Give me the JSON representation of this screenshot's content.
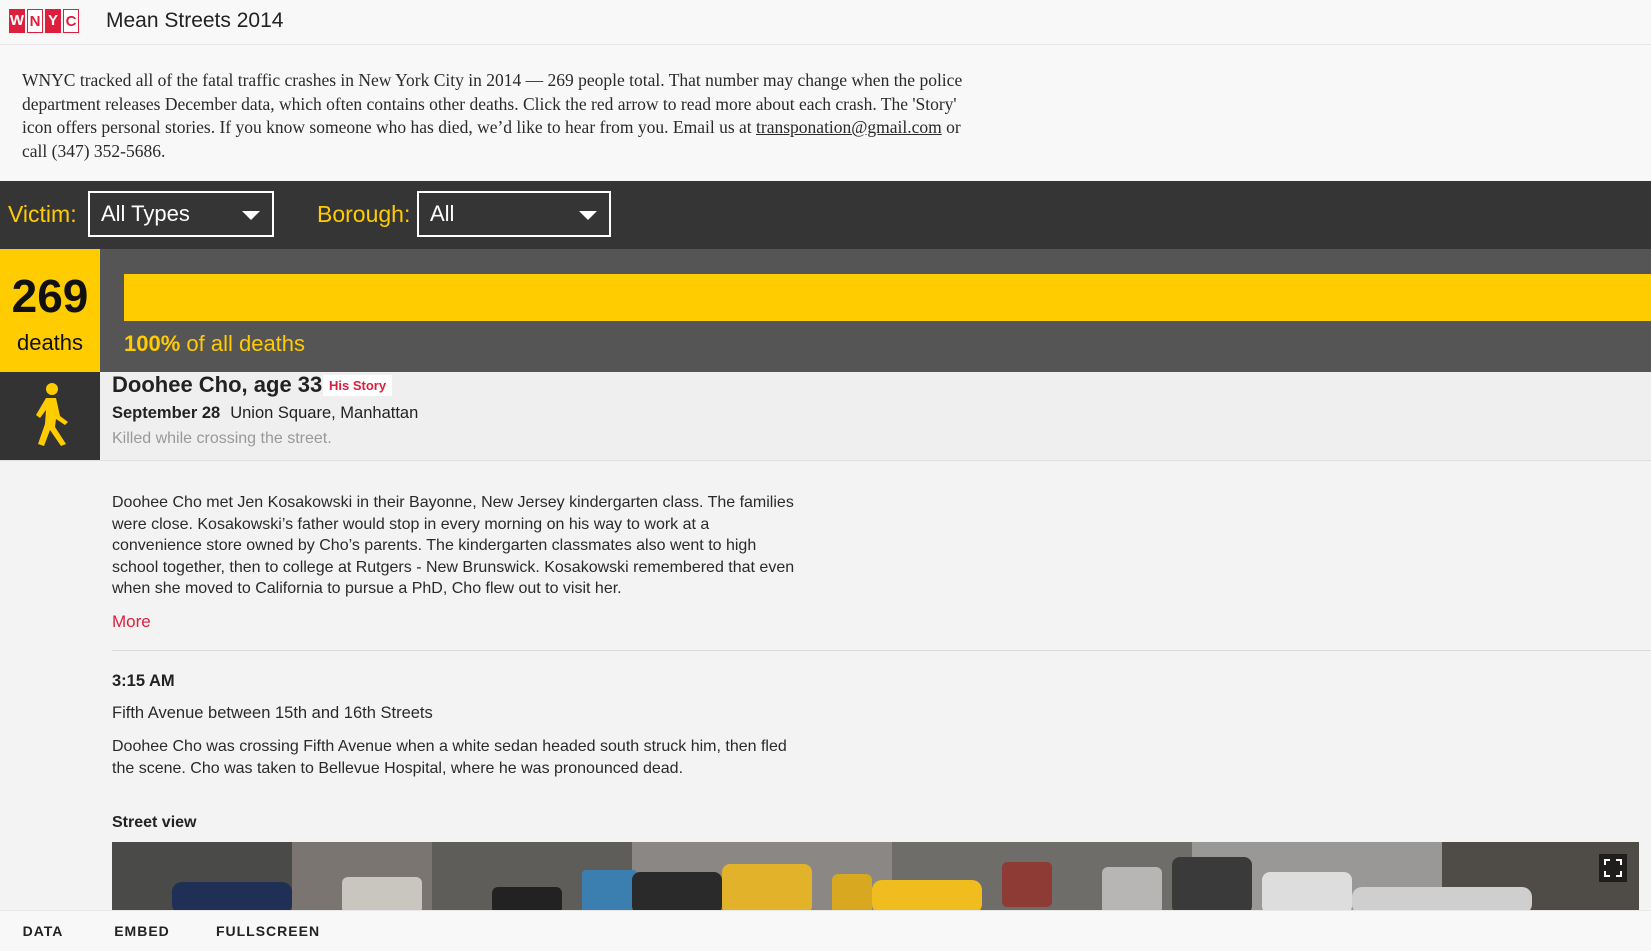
{
  "header": {
    "logo_letters": [
      "W",
      "N",
      "Y",
      "C"
    ],
    "title": "Mean Streets 2014"
  },
  "intro": {
    "text_before_link": "WNYC tracked all of the fatal traffic crashes in New York City in 2014 — 269 people total. That number may change when the police department releases December data, which often contains other deaths. Click the red arrow to read more about each crash. The 'Story' icon offers personal stories. If you know someone who has died, we’d like to hear from you. Email us at ",
    "email": "transponation@gmail.com",
    "text_after_link": " or call (347) 352-5686."
  },
  "filters": {
    "victim_label": "Victim:",
    "victim_value": "All Types",
    "borough_label": "Borough:",
    "borough_value": "All"
  },
  "summary": {
    "count": "269",
    "count_label": "deaths",
    "percent": "100%",
    "percent_label": " of all deaths",
    "bar_fraction": 1.0
  },
  "victim": {
    "icon": "pedestrian-icon",
    "name": "Doohee Cho, age 33",
    "story_badge": "His Story",
    "date": "September 28",
    "location": "Union Square, Manhattan",
    "summary": "Killed while crossing the street.",
    "story": "Doohee Cho met Jen Kosakowski in their Bayonne, New Jersey kindergarten class. The families were close. Kosakowski’s father would stop in every morning on his way to work at a convenience store owned by Cho’s parents. The kindergarten classmates also went to high school together, then to college at Rutgers - New Brunswick. Kosakowski remembered that even when she moved to California to pursue a PhD, Cho flew out to visit her.",
    "more_label": "More",
    "time": "3:15 AM",
    "crash_location": "Fifth Avenue between 15th and 16th Streets",
    "description": "Doohee Cho was crossing Fifth Avenue when a white sedan headed south struck him, then fled the scene. Cho was taken to Bellevue Hospital, where he was pronounced dead.",
    "street_view_label": "Street view"
  },
  "footer": {
    "tabs": [
      "DATA",
      "EMBED",
      "FULLSCREEN"
    ]
  },
  "colors": {
    "accent_yellow": "#ffcc00",
    "brand_red": "#de1e3d",
    "dark_bar": "#353535"
  }
}
